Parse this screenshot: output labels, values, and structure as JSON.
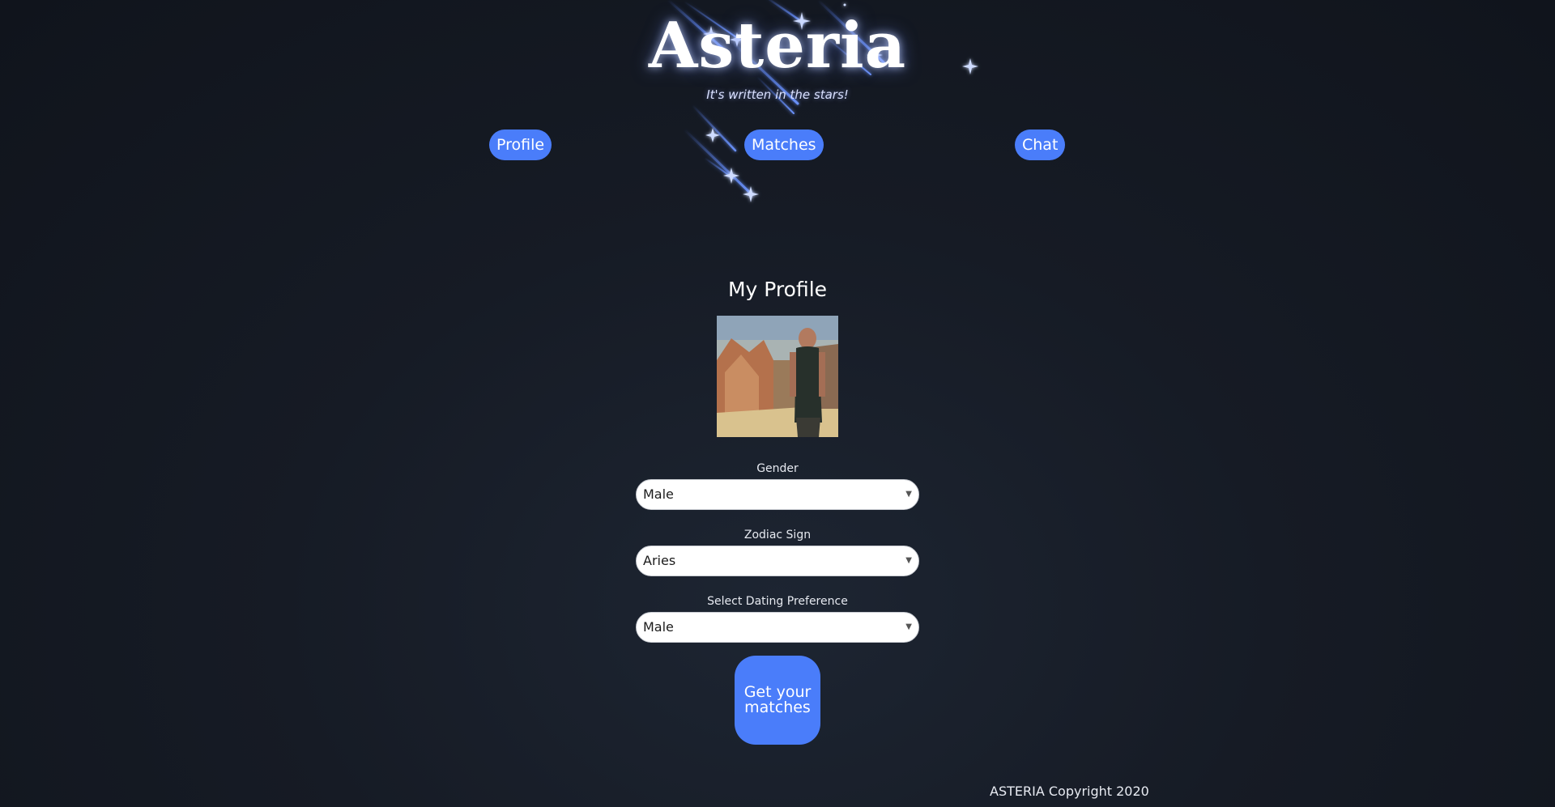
{
  "app": {
    "title": "Asteria",
    "tagline": "It's written in the stars!"
  },
  "nav": {
    "profile": "Profile",
    "matches": "Matches",
    "chat": "Chat"
  },
  "profile": {
    "heading": "My Profile",
    "photo_alt": "Profile photo",
    "fields": {
      "gender": {
        "label": "Gender",
        "value": "Male"
      },
      "zodiac": {
        "label": "Zodiac Sign",
        "value": "Aries"
      },
      "preference": {
        "label": "Select Dating Preference",
        "value": "Male"
      }
    },
    "cta_line1": "Get your",
    "cta_line2": "matches"
  },
  "footer": {
    "copyright": "ASTERIA Copyright 2020"
  },
  "colors": {
    "accent": "#4a7dfa",
    "background": "#161b25",
    "star": "#5b86ff"
  },
  "icons": {
    "select_caret": "chevron-down-icon"
  }
}
